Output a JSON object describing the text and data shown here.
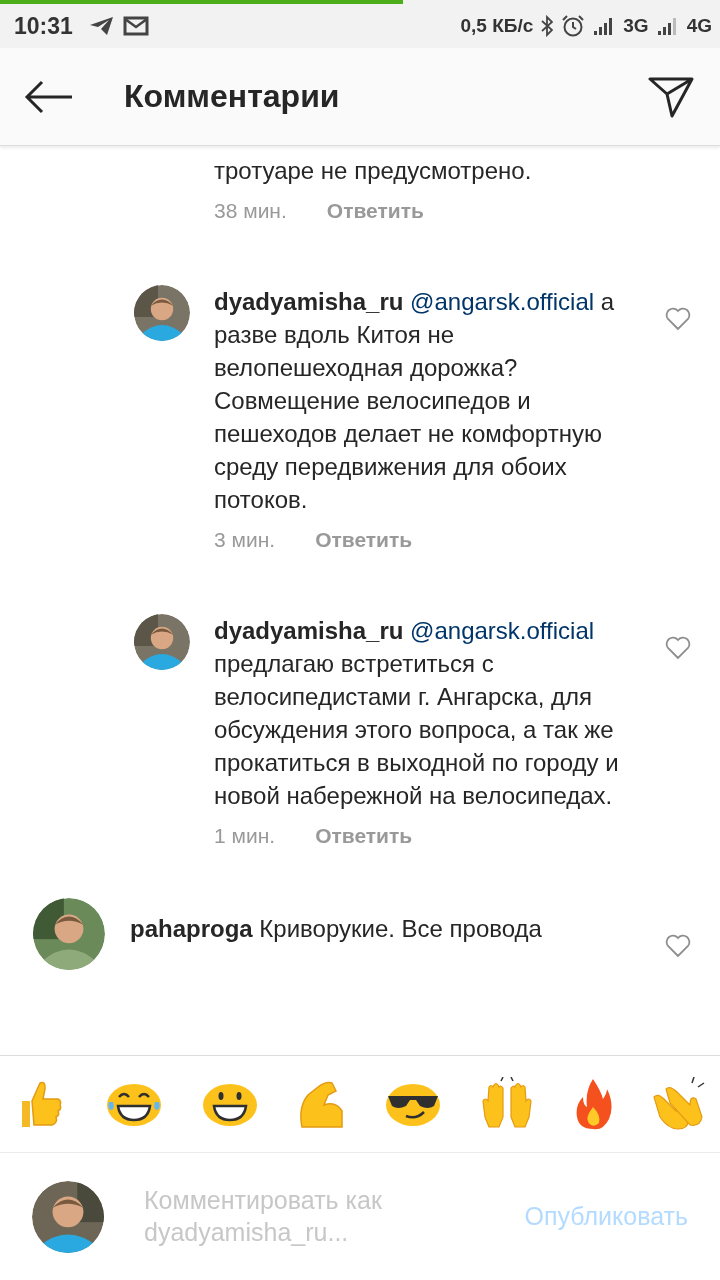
{
  "loading_bar": {
    "level": 0.56
  },
  "status_bar": {
    "time": "10:31",
    "speed": "0,5 КБ/с",
    "network_1": "3G",
    "network_2": "4G"
  },
  "header": {
    "title": "Комментарии"
  },
  "comments": [
    {
      "avatar": false,
      "text": "тротуаре не предусмотрено.",
      "time": "38 мин.",
      "reply": "Ответить"
    },
    {
      "avatar": true,
      "username": "dyadyamisha_ru",
      "mention": "@angarsk.official",
      "text": "а разве вдоль Китоя не велопешеходная дорожка? Совмещение велосипедов и пешеходов делает не комфортную среду передвижения для обоих потоков.",
      "time": "3 мин.",
      "reply": "Ответить",
      "liked": false
    },
    {
      "avatar": true,
      "username": "dyadyamisha_ru",
      "mention": "@angarsk.official",
      "text": "предлагаю встретиться с велосипедистами г. Ангарска, для обсуждения этого вопроса, а так же прокатиться в выходной по городу и новой набережной на велосипедах.",
      "time": "1 мин.",
      "reply": "Ответить",
      "liked": false
    },
    {
      "avatar": true,
      "top_level": true,
      "username": "pahaproga",
      "text": "Криворукие. Все провода",
      "liked": false
    }
  ],
  "emoji_bar": [
    {
      "kind": "thumbs"
    },
    {
      "kind": "tears"
    },
    {
      "kind": "grin"
    },
    {
      "kind": "muscle"
    },
    {
      "kind": "sunglasses"
    },
    {
      "kind": "hands"
    },
    {
      "kind": "fire"
    },
    {
      "kind": "clap"
    }
  ],
  "comment_input": {
    "placeholder": "Комментировать как dyadyamisha_ru...",
    "post": "Опубликовать"
  }
}
